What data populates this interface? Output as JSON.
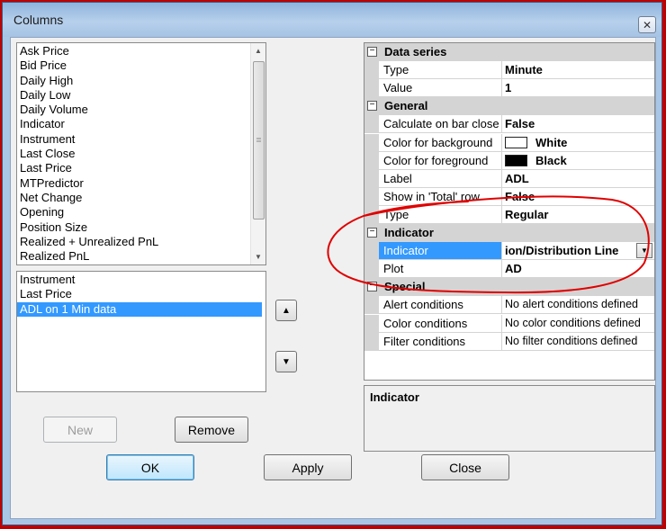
{
  "window": {
    "title": "Columns"
  },
  "available_columns": [
    "Ask Price",
    "Bid Price",
    "Daily High",
    "Daily Low",
    "Daily Volume",
    "Indicator",
    "Instrument",
    "Last Close",
    "Last Price",
    "MTPredictor",
    "Net Change",
    "Opening",
    "Position Size",
    "Realized + Unrealized PnL",
    "Realized PnL"
  ],
  "selected_columns": [
    {
      "label": "Instrument",
      "selected": false
    },
    {
      "label": "Last Price",
      "selected": false
    },
    {
      "label": "ADL on 1 Min data",
      "selected": true
    }
  ],
  "buttons": {
    "new": "New",
    "remove": "Remove",
    "ok": "OK",
    "apply": "Apply",
    "close": "Close"
  },
  "properties": {
    "data_series": {
      "label": "Data series",
      "rows": [
        {
          "name": "Type",
          "value": "Minute"
        },
        {
          "name": "Value",
          "value": "1"
        }
      ]
    },
    "general": {
      "label": "General",
      "rows": [
        {
          "name": "Calculate on bar close",
          "value": "False"
        },
        {
          "name": "Color for background",
          "value": "White",
          "swatch": "#ffffff"
        },
        {
          "name": "Color for foreground",
          "value": "Black",
          "swatch": "#000000"
        },
        {
          "name": "Label",
          "value": "ADL"
        },
        {
          "name": "Show in 'Total' row",
          "value": "False"
        },
        {
          "name": "Type",
          "value": "Regular"
        }
      ]
    },
    "indicator": {
      "label": "Indicator",
      "rows": [
        {
          "name": "Indicator",
          "value": "ion/Distribution Line"
        },
        {
          "name": "Plot",
          "value": "AD"
        }
      ]
    },
    "special": {
      "label": "Special",
      "rows": [
        {
          "name": "Alert conditions",
          "value": "No alert conditions defined"
        },
        {
          "name": "Color conditions",
          "value": "No color conditions defined"
        },
        {
          "name": "Filter conditions",
          "value": "No filter conditions defined"
        }
      ]
    }
  },
  "description": {
    "title": "Indicator"
  },
  "colors": {
    "selection": "#3399ff",
    "annotation": "#e00000",
    "frame": "#c00000"
  }
}
